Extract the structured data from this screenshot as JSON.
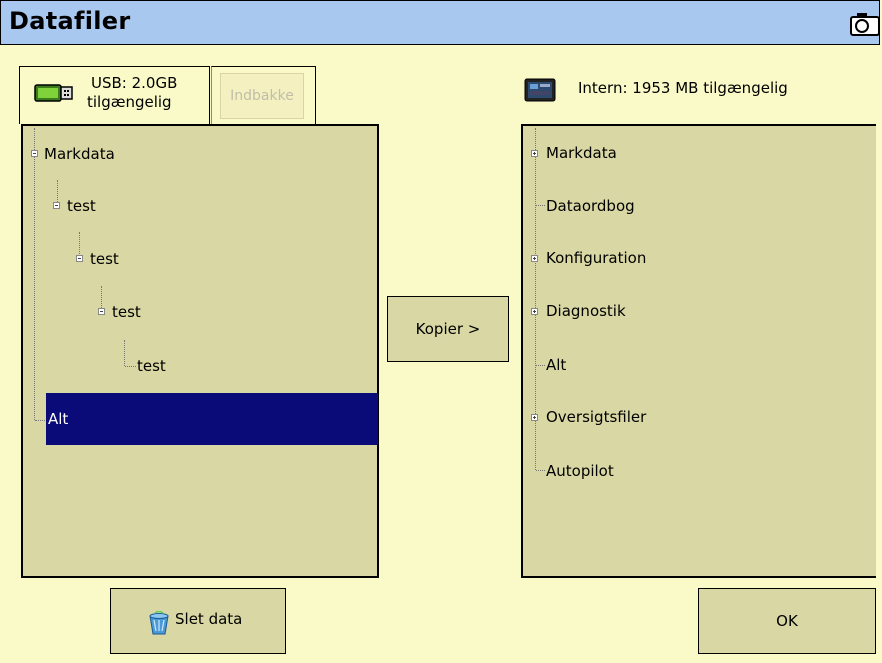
{
  "window": {
    "title": "Datafiler"
  },
  "usb_tab": {
    "line1": "USB: 2.0GB",
    "line2": "tilgængelig"
  },
  "inbox_tab": {
    "label": "Indbakke"
  },
  "intern": {
    "label": "Intern: 1953 MB tilgængelig"
  },
  "left_tree": {
    "items": [
      "Markdata",
      "test",
      "test",
      "test",
      "test",
      "Alt"
    ],
    "selected": "Alt"
  },
  "right_tree": {
    "items": [
      "Markdata",
      "Dataordbog",
      "Konfiguration",
      "Diagnostik",
      "Alt",
      "Oversigtsfiler",
      "Autopilot"
    ]
  },
  "buttons": {
    "copy": "Kopier >",
    "delete": "Slet data",
    "ok": "OK"
  },
  "colors": {
    "title_bar": "#a9c8ef",
    "background": "#fafac8",
    "panel": "#d9d8a4",
    "selection": "#0a0a78"
  },
  "icons": {
    "camera": "camera-icon",
    "usb": "usb-stick-icon",
    "intern": "display-unit-icon",
    "delete": "trash-icon"
  }
}
